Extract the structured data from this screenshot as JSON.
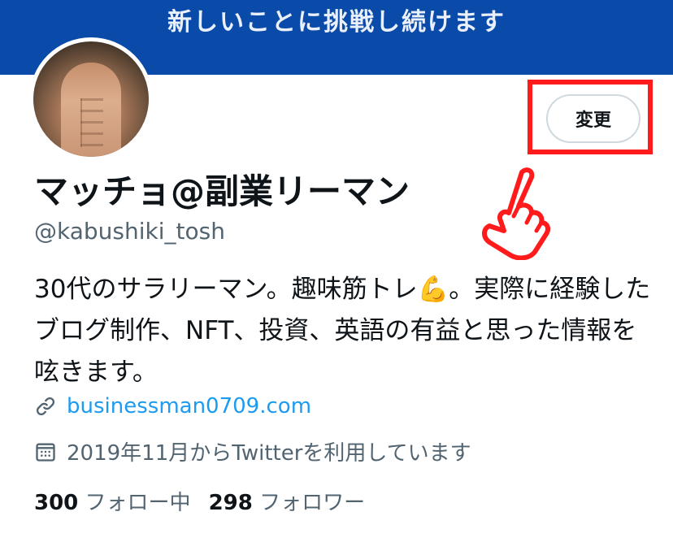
{
  "banner": {
    "text": "新しいことに挑戦し続けます",
    "color": "#0a4aa8"
  },
  "profile": {
    "edit_button_label": "変更",
    "display_name": "マッチョ@副業リーマン",
    "handle": "@kabushiki_tosh",
    "bio_part1": "30代のサラリーマン。趣味筋トレ",
    "bio_emoji": "💪",
    "bio_part2": "。実際に経験したブログ制作、NFT、投資、英語の有益と思った情報を呟きます。",
    "website": "businessman0709.com",
    "joined": "2019年11月からTwitterを利用しています",
    "following_count": "300",
    "following_label": "フォロー中",
    "followers_count": "298",
    "followers_label": "フォロワー"
  },
  "icons": {
    "link": "link-icon",
    "calendar": "calendar-icon",
    "pointer": "pointing-hand-icon"
  },
  "colors": {
    "annotation": "#ff1b1b",
    "link": "#1d9bf0",
    "secondary_text": "#536471"
  }
}
